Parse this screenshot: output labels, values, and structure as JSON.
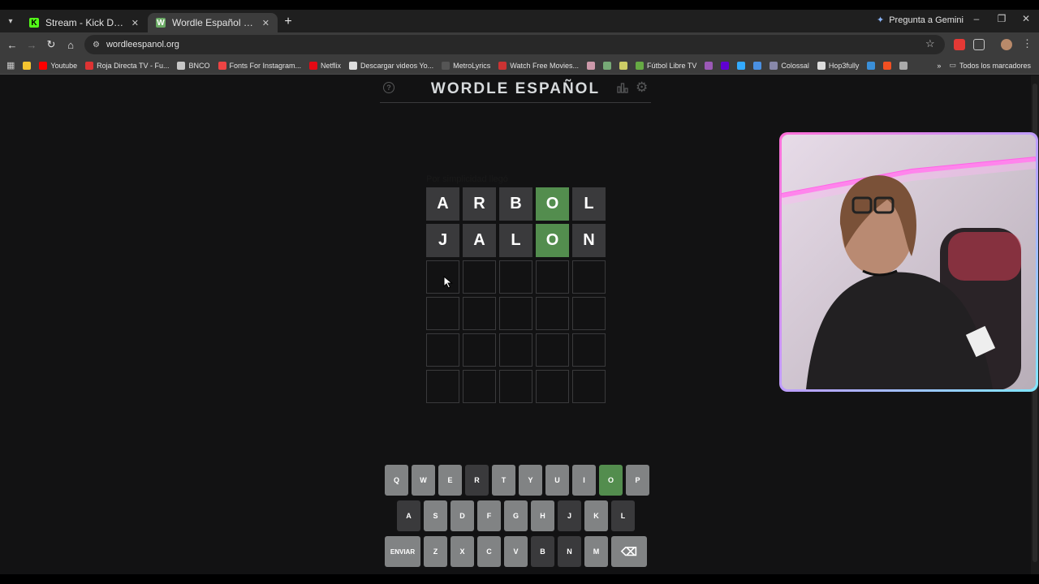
{
  "browser": {
    "tabs": [
      {
        "title": "Stream - Kick Dashboard",
        "favicon": "kick-icon",
        "active": false
      },
      {
        "title": "Wordle Español - Wordle ilimitado",
        "favicon": "wordle-icon",
        "active": true
      }
    ],
    "gemini_label": "Pregunta a Gemini",
    "url": "wordleespanol.org",
    "bookmarks": [
      {
        "label": "",
        "icon": "emoji-icon",
        "color": "#f4c430"
      },
      {
        "label": "Youtube",
        "icon": "youtube-icon",
        "color": "#ff0000"
      },
      {
        "label": "Roja Directa TV - Fu...",
        "icon": "roja-icon",
        "color": "#d33"
      },
      {
        "label": "BNCO",
        "icon": "folder-icon",
        "color": "#c7c7c7"
      },
      {
        "label": "Fonts For Instagram...",
        "icon": "fonts-icon",
        "color": "#e44"
      },
      {
        "label": "Netflix",
        "icon": "netflix-icon",
        "color": "#e50914"
      },
      {
        "label": "Descargar videos Yo...",
        "icon": "download-icon",
        "color": "#ddd"
      },
      {
        "label": "MetroLyrics",
        "icon": "metrolyrics-icon",
        "color": "#555"
      },
      {
        "label": "Watch Free Movies...",
        "icon": "movies-icon",
        "color": "#c33"
      },
      {
        "label": "",
        "icon": "bookmark-icon",
        "color": "#c9a"
      },
      {
        "label": "",
        "icon": "bookmark-icon",
        "color": "#7a7"
      },
      {
        "label": "",
        "icon": "bookmark-icon",
        "color": "#cc6"
      },
      {
        "label": "Fútbol Libre TV",
        "icon": "futbol-icon",
        "color": "#6a4"
      },
      {
        "label": "",
        "icon": "bookmark-icon",
        "color": "#9b59b6"
      },
      {
        "label": "",
        "icon": "yahoo-icon",
        "color": "#6001d2"
      },
      {
        "label": "",
        "icon": "bookmark-icon",
        "color": "#3af"
      },
      {
        "label": "",
        "icon": "bookmark-icon",
        "color": "#4a90e2"
      },
      {
        "label": "Colossal",
        "icon": "colossal-icon",
        "color": "#88a"
      },
      {
        "label": "Hop3fully",
        "icon": "hop-icon",
        "color": "#ddd"
      },
      {
        "label": "",
        "icon": "bookmark-icon",
        "color": "#3a8fd9"
      },
      {
        "label": "",
        "icon": "microsoft-icon",
        "color": "#f25022"
      },
      {
        "label": "",
        "icon": "globe-icon",
        "color": "#aaa"
      }
    ],
    "all_bookmarks_label": "Todos los marcadores"
  },
  "game": {
    "title": "WORDLE ESPAÑOL",
    "faint_text": "Por simplicidad llegó",
    "board": [
      [
        {
          "letter": "A",
          "state": "absent"
        },
        {
          "letter": "R",
          "state": "absent"
        },
        {
          "letter": "B",
          "state": "absent"
        },
        {
          "letter": "O",
          "state": "correct"
        },
        {
          "letter": "L",
          "state": "absent"
        }
      ],
      [
        {
          "letter": "J",
          "state": "absent"
        },
        {
          "letter": "A",
          "state": "absent"
        },
        {
          "letter": "L",
          "state": "absent"
        },
        {
          "letter": "O",
          "state": "correct"
        },
        {
          "letter": "N",
          "state": "absent"
        }
      ],
      [
        {
          "letter": "",
          "state": "empty"
        },
        {
          "letter": "",
          "state": "empty"
        },
        {
          "letter": "",
          "state": "empty"
        },
        {
          "letter": "",
          "state": "empty"
        },
        {
          "letter": "",
          "state": "empty"
        }
      ],
      [
        {
          "letter": "",
          "state": "empty"
        },
        {
          "letter": "",
          "state": "empty"
        },
        {
          "letter": "",
          "state": "empty"
        },
        {
          "letter": "",
          "state": "empty"
        },
        {
          "letter": "",
          "state": "empty"
        }
      ],
      [
        {
          "letter": "",
          "state": "empty"
        },
        {
          "letter": "",
          "state": "empty"
        },
        {
          "letter": "",
          "state": "empty"
        },
        {
          "letter": "",
          "state": "empty"
        },
        {
          "letter": "",
          "state": "empty"
        }
      ],
      [
        {
          "letter": "",
          "state": "empty"
        },
        {
          "letter": "",
          "state": "empty"
        },
        {
          "letter": "",
          "state": "empty"
        },
        {
          "letter": "",
          "state": "empty"
        },
        {
          "letter": "",
          "state": "empty"
        }
      ]
    ],
    "keyboard": [
      [
        {
          "key": "Q",
          "state": "unused"
        },
        {
          "key": "W",
          "state": "unused"
        },
        {
          "key": "E",
          "state": "unused"
        },
        {
          "key": "R",
          "state": "absent"
        },
        {
          "key": "T",
          "state": "unused"
        },
        {
          "key": "Y",
          "state": "unused"
        },
        {
          "key": "U",
          "state": "unused"
        },
        {
          "key": "I",
          "state": "unused"
        },
        {
          "key": "O",
          "state": "correct"
        },
        {
          "key": "P",
          "state": "unused"
        }
      ],
      [
        {
          "key": "A",
          "state": "absent"
        },
        {
          "key": "S",
          "state": "unused"
        },
        {
          "key": "D",
          "state": "unused"
        },
        {
          "key": "F",
          "state": "unused"
        },
        {
          "key": "G",
          "state": "unused"
        },
        {
          "key": "H",
          "state": "unused"
        },
        {
          "key": "J",
          "state": "absent"
        },
        {
          "key": "K",
          "state": "unused"
        },
        {
          "key": "L",
          "state": "absent"
        }
      ],
      [
        {
          "key": "ENVIAR",
          "state": "unused"
        },
        {
          "key": "Z",
          "state": "unused"
        },
        {
          "key": "X",
          "state": "unused"
        },
        {
          "key": "C",
          "state": "unused"
        },
        {
          "key": "V",
          "state": "unused"
        },
        {
          "key": "B",
          "state": "absent"
        },
        {
          "key": "N",
          "state": "absent"
        },
        {
          "key": "M",
          "state": "unused"
        },
        {
          "key": "⌫",
          "state": "unused"
        }
      ]
    ]
  },
  "colors": {
    "correct": "#538d4e",
    "present": "#b59f3b",
    "absent": "#3a3a3c",
    "unused_key": "#818384",
    "webcam_border_start": "#ff6fd8",
    "webcam_border_end": "#7fe7ff"
  }
}
